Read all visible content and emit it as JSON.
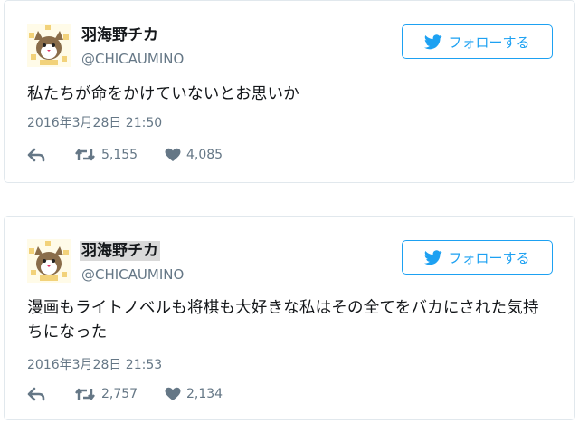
{
  "colors": {
    "accent": "#1da1f2",
    "text": "#14171a",
    "muted": "#657786",
    "border": "#e1e8ed",
    "highlight": "#d9d9d9"
  },
  "tweets": [
    {
      "display_name": "羽海野チカ",
      "screen_name": "@CHICAUMINO",
      "follow_label": "フォローする",
      "text": "私たちが命をかけていないとお思いか",
      "timestamp": "2016年3月28日 21:50",
      "retweets": "5,155",
      "likes": "4,085",
      "name_highlighted": false,
      "icons": {
        "avatar": "cat-avatar-icon",
        "follow": "twitter-bird-icon",
        "reply": "reply-icon",
        "retweet": "retweet-icon",
        "like": "heart-icon"
      }
    },
    {
      "display_name": "羽海野チカ",
      "screen_name": "@CHICAUMINO",
      "follow_label": "フォローする",
      "text": "漫画もライトノベルも将棋も大好きな私はその全てをバカにされた気持ちになった",
      "timestamp": "2016年3月28日 21:53",
      "retweets": "2,757",
      "likes": "2,134",
      "name_highlighted": true,
      "icons": {
        "avatar": "cat-avatar-icon",
        "follow": "twitter-bird-icon",
        "reply": "reply-icon",
        "retweet": "retweet-icon",
        "like": "heart-icon"
      }
    }
  ]
}
